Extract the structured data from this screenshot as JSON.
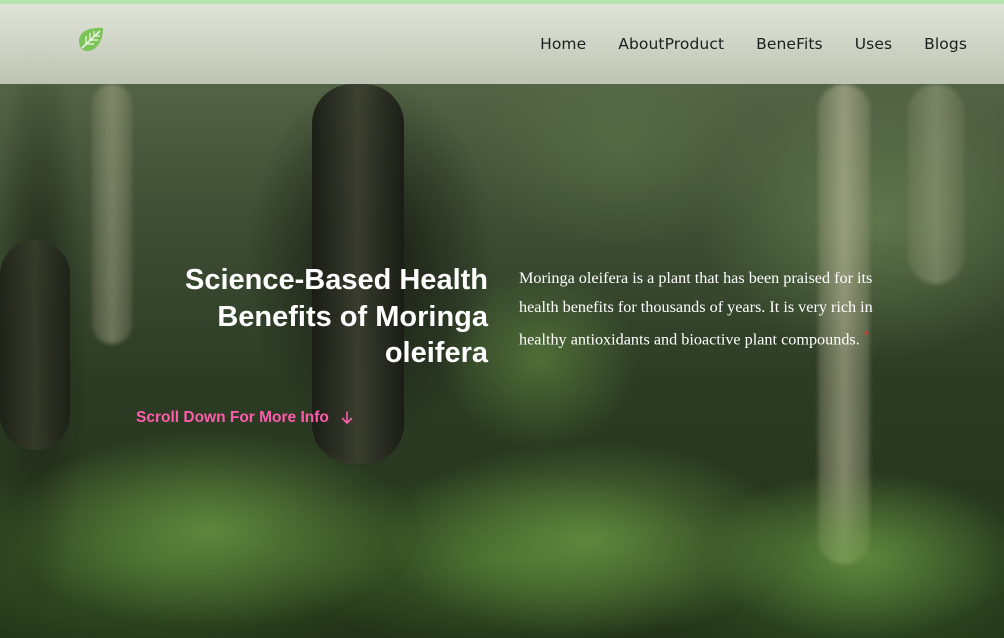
{
  "nav": {
    "logo_icon": "leaf-icon",
    "links": [
      "Home",
      "AboutProduct",
      "BeneFits",
      "Uses",
      "Blogs"
    ]
  },
  "hero": {
    "headline": "Science-Based Health Benefits of Moringa oleifera",
    "scroll_label": "Scroll Down For More Info",
    "scroll_icon": "arrow-down-icon",
    "description": "Moringa oleifera is a plant that has been praised for its health benefits for thousands of years. It is very rich in healthy antioxidants and bioactive plant compounds.",
    "reference_mark": "*"
  },
  "colors": {
    "accent_pink": "#ff5cab",
    "logo_green": "#7cc35a",
    "top_strip": "#b9e3b0"
  }
}
